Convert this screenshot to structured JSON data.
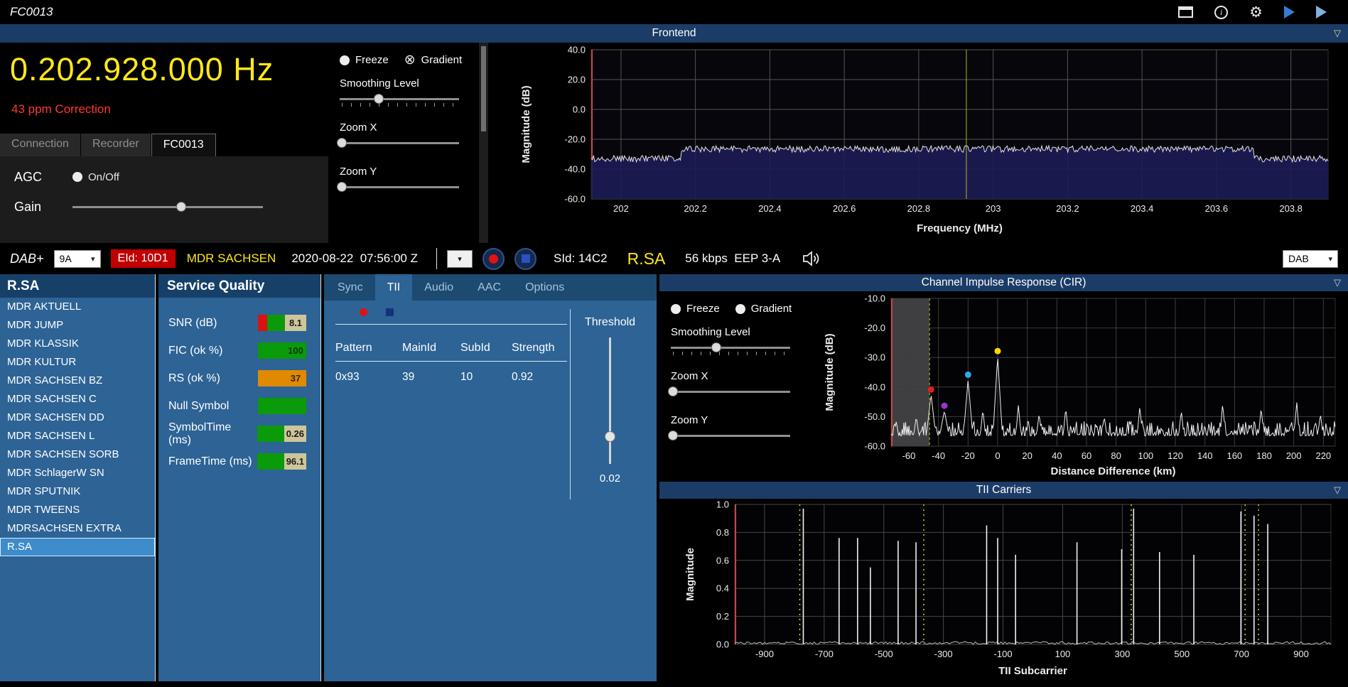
{
  "titlebar": {
    "title": "FC0013"
  },
  "icons": {
    "info": "i",
    "gear": "⚙",
    "dropdown": "▾",
    "panel_collapse": "▽",
    "gradient_cross": "⊗"
  },
  "frontend": {
    "header": "Frontend",
    "frequency": "0.202.928.000 Hz",
    "correction": "43 ppm Correction",
    "tabs": [
      "Connection",
      "Recorder",
      "FC0013"
    ],
    "active_tab": 2,
    "agc_label": "AGC",
    "agc_toggle": "On/Off",
    "gain_label": "Gain",
    "controls": {
      "freeze": "Freeze",
      "gradient": "Gradient",
      "smoothing": "Smoothing Level",
      "zoom_x": "Zoom X",
      "zoom_y": "Zoom Y"
    }
  },
  "dabbar": {
    "mode": "DAB+",
    "channel": "9A",
    "eid": "EId: 10D1",
    "ensemble": "MDR SACHSEN",
    "datetime": "2020-08-22  07:56:00 Z",
    "sid": "SId: 14C2",
    "service": "R.SA",
    "bitrate": "56 kbps  EEP 3-A",
    "right_dropdown": "DAB"
  },
  "services": {
    "header": "R.SA",
    "selected_index": 13,
    "items": [
      "MDR AKTUELL",
      "MDR JUMP",
      "MDR KLASSIK",
      "MDR KULTUR",
      "MDR SACHSEN BZ",
      "MDR SACHSEN C",
      "MDR SACHSEN DD",
      "MDR SACHSEN L",
      "MDR SACHSEN SORB",
      "MDR SchlagerW SN",
      "MDR SPUTNIK",
      "MDR TWEENS",
      "MDRSACHSEN EXTRA",
      "R.SA"
    ]
  },
  "quality": {
    "header": "Service Quality",
    "rows": [
      {
        "label": "SNR (dB)",
        "segments": [
          {
            "color": "#dd1111",
            "w": 13
          },
          {
            "color": "#0a9a0a",
            "w": 25
          }
        ],
        "value": "8.1",
        "value_bg": "#cdc69a",
        "value_color": "#1a1a1a"
      },
      {
        "label": "FIC (ok %)",
        "segments": [
          {
            "color": "#0a9a0a",
            "w": 38
          }
        ],
        "value": "100",
        "value_bg": "#0a9a0a",
        "value_color": "#0c3a0c"
      },
      {
        "label": "RS (ok %)",
        "segments": [
          {
            "color": "#e08a00",
            "w": 38
          }
        ],
        "value": "37",
        "value_bg": "#e08a00",
        "value_color": "#3a2600"
      },
      {
        "label": "Null Symbol",
        "segments": [
          {
            "color": "#0a9a0a",
            "w": 68
          }
        ],
        "value": "",
        "value_bg": "",
        "value_color": ""
      },
      {
        "label": "SymbolTime (ms)",
        "segments": [
          {
            "color": "#0a9a0a",
            "w": 38
          }
        ],
        "value": "0.26",
        "value_bg": "#cdc69a",
        "value_color": "#1a1a1a"
      },
      {
        "label": "FrameTime (ms)",
        "segments": [
          {
            "color": "#0a9a0a",
            "w": 38
          }
        ],
        "value": "96.1",
        "value_bg": "#cdc69a",
        "value_color": "#1a1a1a"
      }
    ]
  },
  "decoder": {
    "tabs": [
      "Sync",
      "TII",
      "Audio",
      "AAC",
      "Options"
    ],
    "active_tab": 1,
    "table": {
      "headers": [
        "Pattern",
        "MainId",
        "SubId",
        "Strength"
      ],
      "rows": [
        [
          "0x93",
          "39",
          "10",
          "0.92"
        ]
      ]
    },
    "threshold_label": "Threshold",
    "threshold_value": "0.02"
  },
  "cir": {
    "header": "Channel Impulse Response (CIR)",
    "controls": {
      "freeze": "Freeze",
      "gradient": "Gradient",
      "smoothing": "Smoothing Level",
      "zoom_x": "Zoom X",
      "zoom_y": "Zoom Y"
    }
  },
  "tii": {
    "header": "TII Carriers"
  },
  "sliders": {
    "frontend-smoothing-slider": 33,
    "frontend-zoomx-slider": 2,
    "frontend-zoomy-slider": 2,
    "gain-slider": 57,
    "cir-smoothing-slider": 38,
    "cir-zoomx-slider": 2,
    "cir-zoomy-slider": 2,
    "threshold-slider": 78
  },
  "chart_data": [
    {
      "id": "spectrum",
      "type": "line",
      "title": "Frontend",
      "xlabel": "Frequency (MHz)",
      "ylabel": "Magnitude (dB)",
      "xlim": [
        201.92,
        203.9
      ],
      "ylim": [
        -60,
        40
      ],
      "xticks": [
        202,
        202.2,
        202.4,
        202.6,
        202.8,
        203,
        203.2,
        203.4,
        203.6,
        203.8
      ],
      "xtick_labels": [
        "202",
        "202.2",
        "202.4",
        "202.6",
        "202.8",
        "203",
        "203.2",
        "203.4",
        "203.6",
        "203.8"
      ],
      "yticks": [
        40,
        20,
        0,
        -20,
        -40,
        -60
      ],
      "ytick_labels": [
        "40.0",
        "20.0",
        "0.0",
        "-20.0",
        "-40.0",
        "-60.0"
      ],
      "noise_floor_db": -33,
      "signal_level_db": -26.5,
      "signal_band": [
        202.16,
        203.7
      ],
      "noise_amp_db": 2.2,
      "cursor_mhz": 202.928,
      "fill_color": "#1c1c55",
      "trace_color": "#e4e4e4"
    },
    {
      "id": "cir",
      "type": "line",
      "title": "Channel Impulse Response (CIR)",
      "xlabel": "Distance Difference (km)",
      "ylabel": "Magnitude (dB)",
      "xlim": [
        -72,
        228
      ],
      "ylim": [
        -60,
        -10
      ],
      "xticks": [
        -60,
        -40,
        -20,
        0,
        20,
        40,
        60,
        80,
        100,
        120,
        140,
        160,
        180,
        200,
        220
      ],
      "xtick_labels": [
        "-60",
        "-40",
        "-20",
        "0",
        "20",
        "40",
        "60",
        "80",
        "100",
        "120",
        "140",
        "160",
        "180",
        "200",
        "220"
      ],
      "yticks": [
        -10,
        -20,
        -30,
        -40,
        -50,
        -60
      ],
      "ytick_labels": [
        "-10.0",
        "-20.0",
        "-30.0",
        "-40.0",
        "-50.0",
        "-60.0"
      ],
      "noise_floor_db": -56.5,
      "noise_amp_db": 5,
      "peaks": [
        {
          "x": -45,
          "y": -42.5,
          "marker_color": "#e02020"
        },
        {
          "x": -36,
          "y": -48,
          "marker_color": "#9932cc"
        },
        {
          "x": -20,
          "y": -37.5,
          "marker_color": "#2fa8e8"
        },
        {
          "x": 0,
          "y": -29.5,
          "marker_color": "#ffd700"
        }
      ],
      "minor_peaks": [
        {
          "x": -55,
          "y": -50
        },
        {
          "x": -10,
          "y": -47.5
        },
        {
          "x": 14,
          "y": -46
        },
        {
          "x": 28,
          "y": -49
        },
        {
          "x": 46,
          "y": -47
        },
        {
          "x": 72,
          "y": -50
        },
        {
          "x": 96,
          "y": -46.5
        },
        {
          "x": 124,
          "y": -48
        },
        {
          "x": 152,
          "y": -45.5
        },
        {
          "x": 178,
          "y": -47
        },
        {
          "x": 202,
          "y": -45
        },
        {
          "x": 218,
          "y": -49
        }
      ],
      "shaded_region": [
        -72,
        -46
      ],
      "threshold_marker_x": -46,
      "trace_color": "#f0f0f0"
    },
    {
      "id": "tii",
      "type": "impulse",
      "title": "TII Carriers",
      "xlabel": "TII Subcarrier",
      "ylabel": "Magnitude",
      "xlim": [
        -1000,
        1000
      ],
      "ylim": [
        0,
        1
      ],
      "xticks": [
        -900,
        -700,
        -500,
        -300,
        -100,
        100,
        300,
        500,
        700,
        900
      ],
      "xtick_labels": [
        "-900",
        "-700",
        "-500",
        "-300",
        "-100",
        "100",
        "300",
        "500",
        "700",
        "900"
      ],
      "yticks": [
        1,
        0.8,
        0.6,
        0.4,
        0.2,
        0
      ],
      "ytick_labels": [
        "1.0",
        "0.8",
        "0.6",
        "0.4",
        "0.2",
        "0.0"
      ],
      "impulses": [
        {
          "x": -770,
          "h": 0.97
        },
        {
          "x": -650,
          "h": 0.76
        },
        {
          "x": -588,
          "h": 0.76
        },
        {
          "x": -545,
          "h": 0.55
        },
        {
          "x": -452,
          "h": 0.74
        },
        {
          "x": -392,
          "h": 0.73
        },
        {
          "x": -155,
          "h": 0.85
        },
        {
          "x": -118,
          "h": 0.76
        },
        {
          "x": -58,
          "h": 0.64
        },
        {
          "x": 148,
          "h": 0.73
        },
        {
          "x": 298,
          "h": 0.68
        },
        {
          "x": 338,
          "h": 0.97
        },
        {
          "x": 425,
          "h": 0.66
        },
        {
          "x": 540,
          "h": 0.64
        },
        {
          "x": 698,
          "h": 0.95
        },
        {
          "x": 742,
          "h": 0.92
        },
        {
          "x": 788,
          "h": 0.86
        }
      ],
      "marker_lines_x": [
        -782,
        -366,
        330,
        712,
        757
      ],
      "impulse_color": "#f0f0f0",
      "marker_color": "#d8d020"
    }
  ]
}
